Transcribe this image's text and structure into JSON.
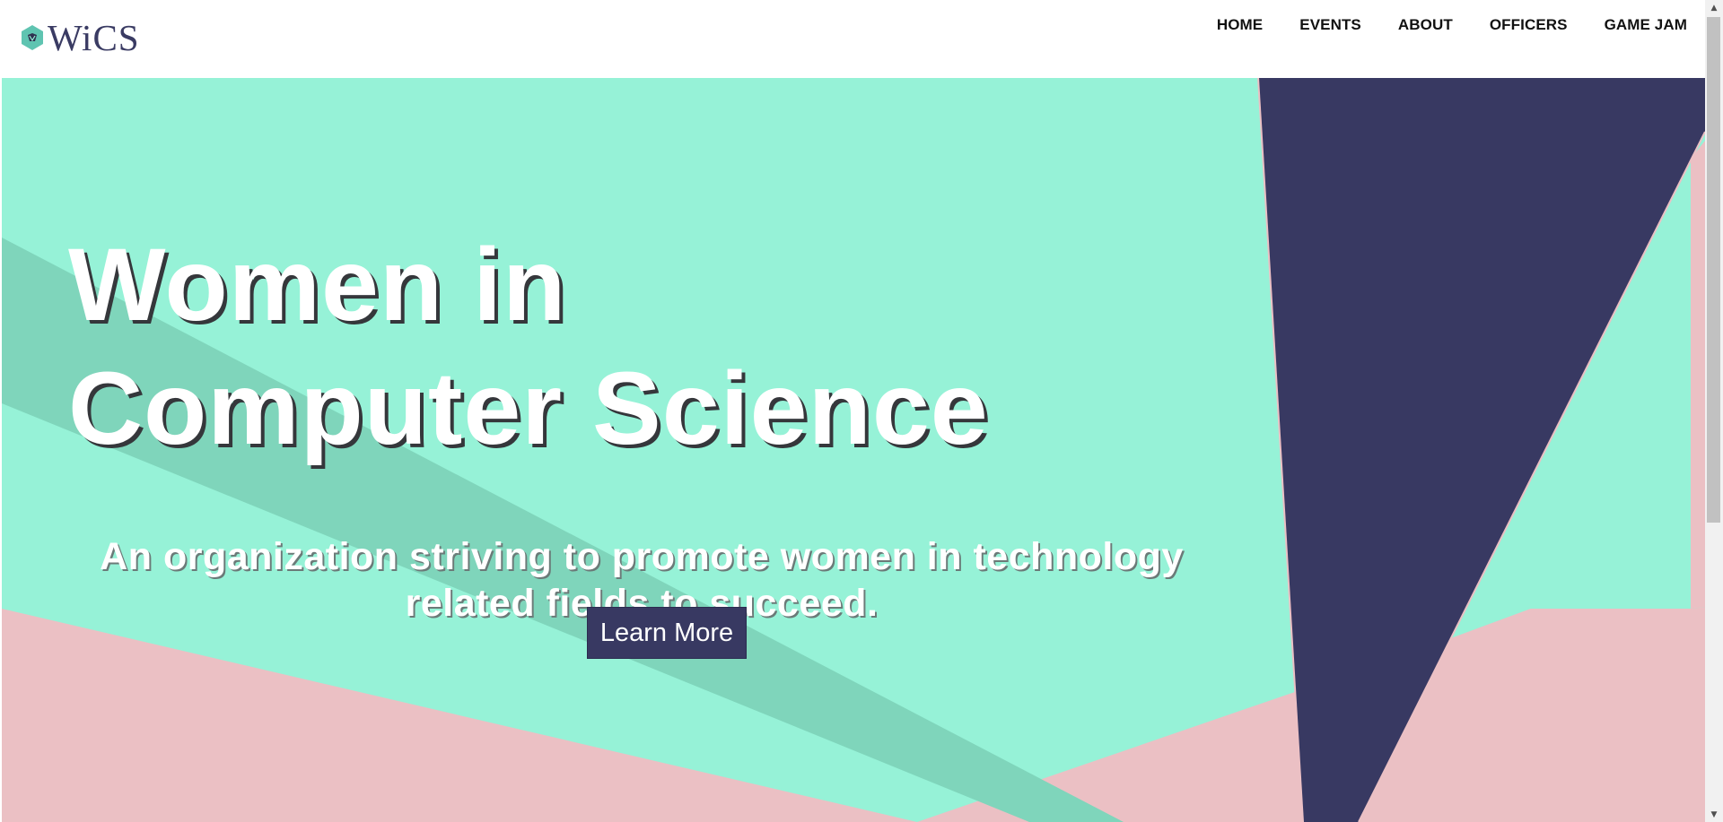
{
  "brand": {
    "logo_text": "WiCS",
    "logo_icon": "hexagon-flower-logo-icon",
    "colors": {
      "navy": "#383962",
      "mint": "#96f2d7",
      "pink": "#ebc0c4",
      "teal_stripe": "#7fd5bb"
    }
  },
  "nav": {
    "items": [
      {
        "label": "HOME"
      },
      {
        "label": "EVENTS"
      },
      {
        "label": "ABOUT"
      },
      {
        "label": "OFFICERS"
      },
      {
        "label": "GAME JAM"
      }
    ]
  },
  "hero": {
    "title_line1": "Women in",
    "title_line2": "Computer Science",
    "subtitle": "An organization striving to promote women in technology related fields to succeed.",
    "cta_label": "Learn More"
  },
  "scrollbar": {
    "up_icon": "scroll-up-arrow-icon",
    "down_icon": "scroll-down-arrow-icon"
  }
}
